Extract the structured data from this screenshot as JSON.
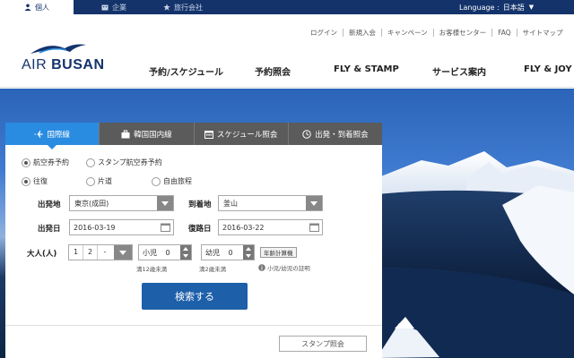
{
  "topbar": {
    "tabs": [
      {
        "label": "個人",
        "icon": "person-icon",
        "active": true
      },
      {
        "label": "企業",
        "icon": "building-icon",
        "active": false
      },
      {
        "label": "旅行会社",
        "icon": "star-icon",
        "active": false
      }
    ],
    "language_label": "Language :",
    "language_value": "日本語"
  },
  "header": {
    "logo_text_1": "AIR",
    "logo_text_2": "BUSAN",
    "utility_links": [
      "ログイン",
      "新規入会",
      "キャンペーン",
      "お客様センター",
      "FAQ",
      "サイトマップ"
    ],
    "nav": [
      "予約/スケジュール",
      "予約照会",
      "FLY & STAMP",
      "サービス案内",
      "FLY & JOY"
    ]
  },
  "booking": {
    "tabs": [
      {
        "label": "国際線",
        "icon": "plane-icon",
        "active": true
      },
      {
        "label": "韓国国内線",
        "icon": "suitcase-icon",
        "active": false
      },
      {
        "label": "スケジュール照会",
        "icon": "calendar-icon",
        "active": false
      },
      {
        "label": "出発・到着照会",
        "icon": "clock-icon",
        "active": false
      }
    ],
    "ticket_type": {
      "options": [
        "航空券予約",
        "スタンプ航空券予約"
      ],
      "selected_index": 0
    },
    "trip_type": {
      "options": [
        "往復",
        "片道",
        "自由旅程"
      ],
      "selected_index": 0
    },
    "departure_label": "出発地",
    "departure_value": "東京(成田)",
    "arrival_label": "到着地",
    "arrival_value": "釜山",
    "depart_date_label": "出発日",
    "depart_date_value": "2016-03-19",
    "return_date_label": "復路日",
    "return_date_value": "2016-03-22",
    "adult_label": "大人(人)",
    "adult_options": [
      "1",
      "2",
      "-"
    ],
    "child_label": "小児",
    "child_value": "0",
    "infant_label": "幼児",
    "infant_value": "0",
    "age_calc_label": "年齢計算機",
    "child_note": "満12歳未満",
    "infant_note": "満2歳未満",
    "proof_note": "小児/幼児の証明",
    "search_label": "検索する",
    "stamp_inquiry_label": "スタンプ照会"
  },
  "colors": {
    "brand_navy": "#14336b",
    "tab_active": "#2a8ce0",
    "search_button": "#1d5fa9"
  }
}
